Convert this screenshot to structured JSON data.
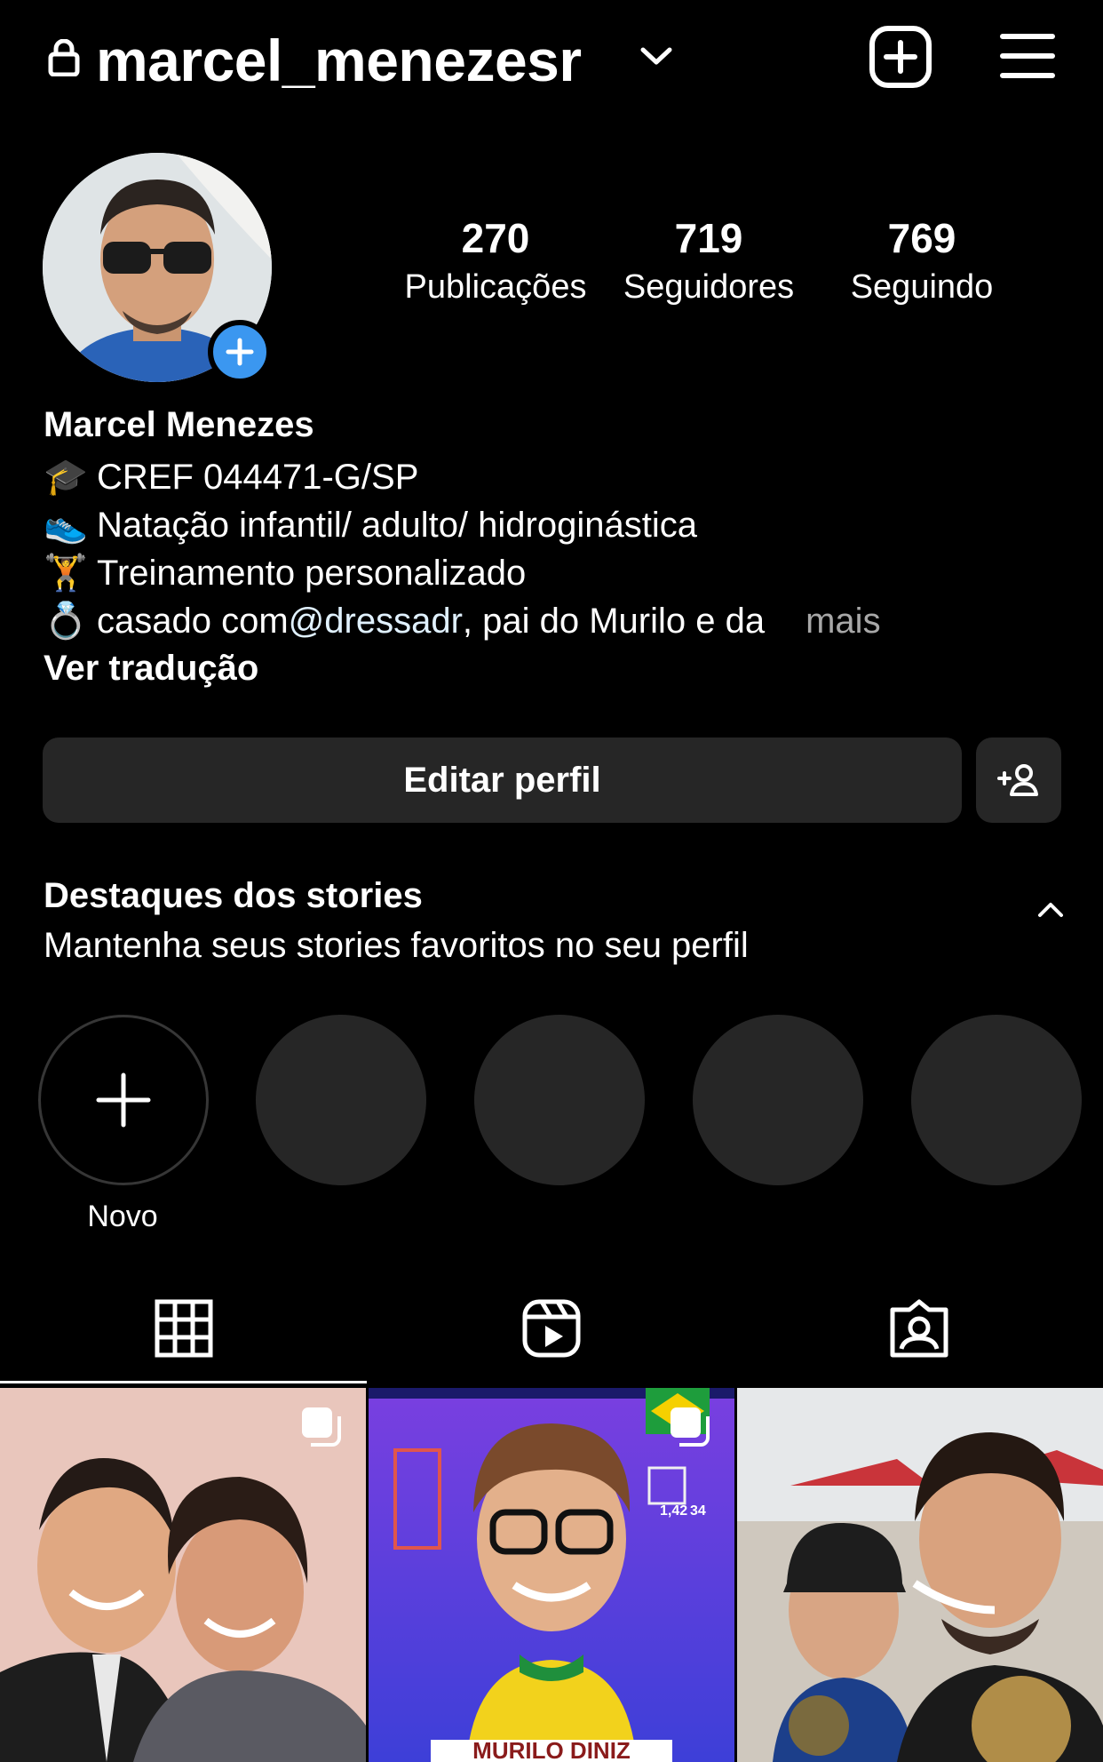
{
  "header": {
    "username": "marcel_menezesr",
    "icons": {
      "lock": "lock-icon",
      "switch": "chevron-down-icon",
      "create": "plus-square-icon",
      "menu": "hamburger-menu-icon"
    }
  },
  "stats": [
    {
      "value": "270",
      "label": "Publicações"
    },
    {
      "value": "719",
      "label": "Seguidores"
    },
    {
      "value": "769",
      "label": "Seguindo"
    }
  ],
  "bio": {
    "name": "Marcel Menezes",
    "lines": [
      {
        "emoji": "🎓",
        "text": "CREF 044471-G/SP"
      },
      {
        "emoji": "👟",
        "text": "Natação infantil/ adulto/ hidroginástica"
      },
      {
        "emoji": "🏋",
        "text": "Treinamento personalizado"
      },
      {
        "emoji": "💍",
        "text_before": "casado com ",
        "mention": "@dressadr",
        "text_after": ", pai do Murilo e da",
        "more": "mais"
      }
    ],
    "translate": "Ver tradução"
  },
  "actions": {
    "edit_profile": "Editar perfil"
  },
  "highlights": {
    "title": "Destaques dos stories",
    "subtitle": "Mantenha seus stories favoritos no seu perfil",
    "new_label": "Novo"
  },
  "tabs": [
    {
      "name": "grid",
      "icon": "grid-icon",
      "active": true
    },
    {
      "name": "reels",
      "icon": "reels-icon",
      "active": false
    },
    {
      "name": "tagged",
      "icon": "tagged-icon",
      "active": false
    }
  ],
  "posts": [
    {
      "kind": "photo",
      "multi": true
    },
    {
      "kind": "sticker",
      "multi": true,
      "caption": "MURILO DINIZ",
      "stats": [
        "1,42",
        "34"
      ]
    },
    {
      "kind": "photo",
      "multi": false
    }
  ],
  "colors": {
    "background": "#000000",
    "button": "#262626",
    "accent": "#3b97f0"
  }
}
